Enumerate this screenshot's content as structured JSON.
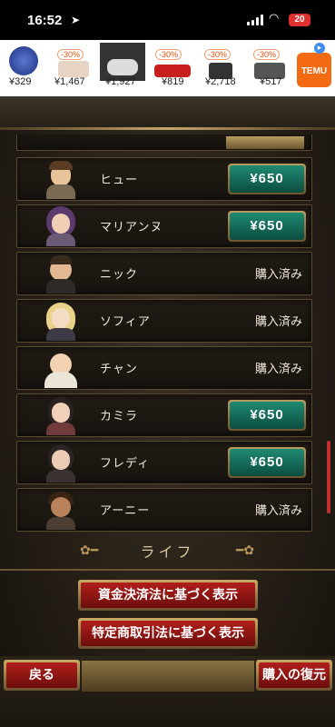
{
  "status_bar": {
    "time": "16:52",
    "battery": "20"
  },
  "ad_banner": {
    "prices": [
      "¥329",
      "¥1,467",
      "¥1,927",
      "¥819",
      "¥2,718",
      "¥517"
    ],
    "discounts": [
      "-30%",
      "-30%",
      "-30%",
      "-30%",
      "-30%"
    ],
    "brand": "TEMU"
  },
  "character_list": [
    {
      "name": "ヒュー",
      "price": "¥650",
      "purchased": false
    },
    {
      "name": "マリアンヌ",
      "price": "¥650",
      "purchased": false
    },
    {
      "name": "ニック",
      "status": "購入済み",
      "purchased": true
    },
    {
      "name": "ソフィア",
      "status": "購入済み",
      "purchased": true
    },
    {
      "name": "チャン",
      "status": "購入済み",
      "purchased": true
    },
    {
      "name": "カミラ",
      "price": "¥650",
      "purchased": false
    },
    {
      "name": "フレディ",
      "price": "¥650",
      "purchased": false
    },
    {
      "name": "アーニー",
      "status": "購入済み",
      "purchased": true
    }
  ],
  "section_title": "ライフ",
  "legal_buttons": {
    "payment_services": "資金決済法に基づく表示",
    "commercial_transactions": "特定商取引法に基づく表示"
  },
  "footer": {
    "back_label": "戻る",
    "restore_label": "購入の復元"
  },
  "colors": {
    "price_button": "#1f8a73",
    "red_button": "#b01f1b",
    "gold": "#c7a86a"
  }
}
